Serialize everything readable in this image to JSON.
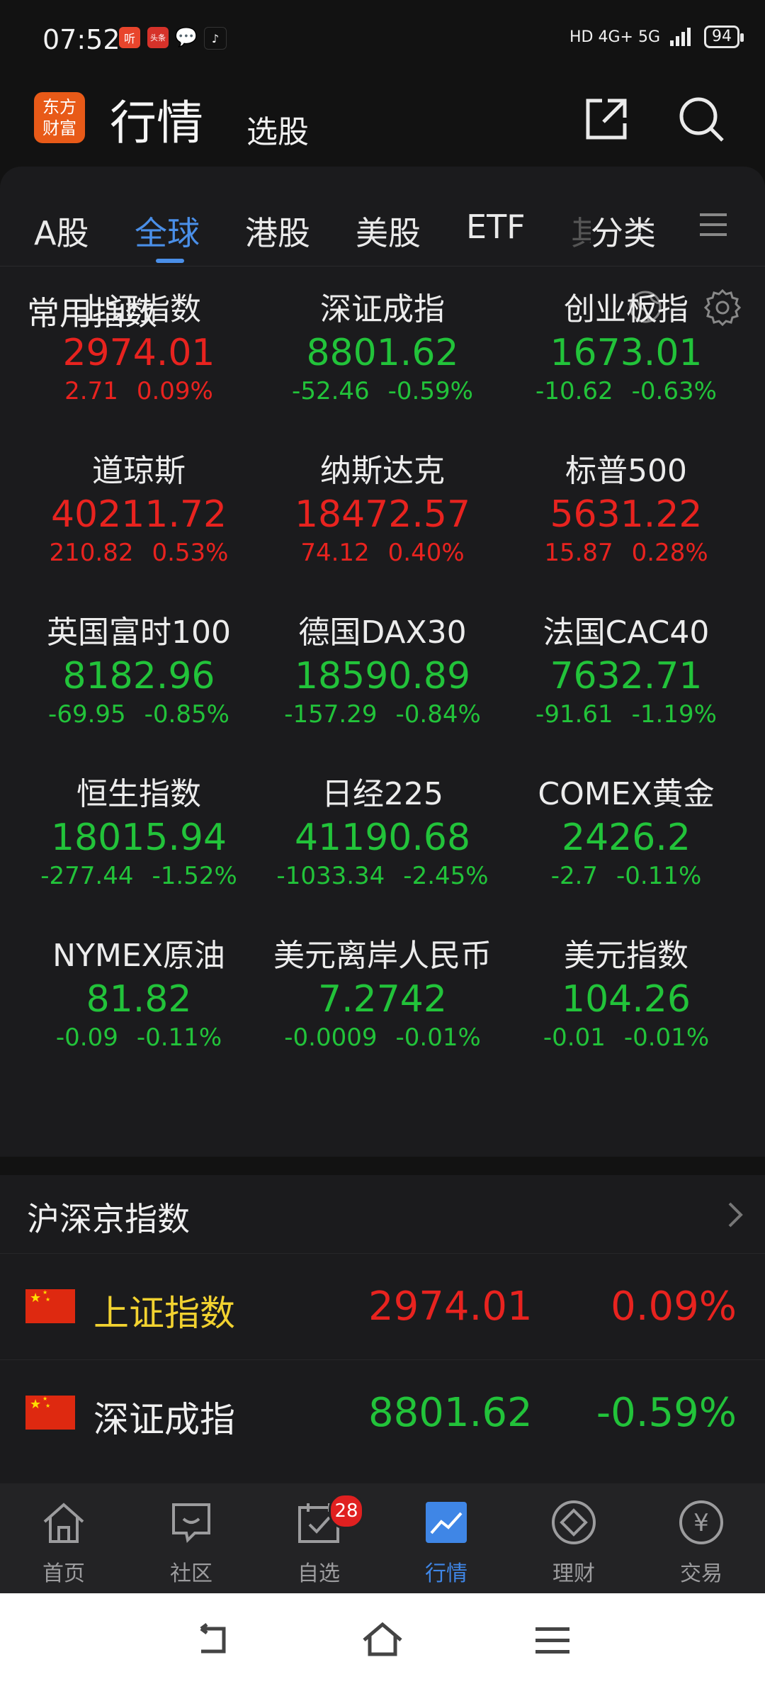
{
  "status": {
    "time": "07:52",
    "apps": [
      "听",
      "头条",
      "💬",
      "♪"
    ],
    "network": "HD 4G+ 5G",
    "battery": "94"
  },
  "header": {
    "logo_line1": "东方",
    "logo_line2": "财富",
    "title": "行情",
    "subtitle": "选股"
  },
  "tabs": [
    "A股",
    "全球",
    "港股",
    "美股",
    "ETF",
    "其",
    "分类"
  ],
  "common_indices": {
    "title": "常用指数",
    "items": [
      {
        "name": "上证指数",
        "price": "2974.01",
        "change": "2.71",
        "pct": "0.09%",
        "dir": "up"
      },
      {
        "name": "深证成指",
        "price": "8801.62",
        "change": "-52.46",
        "pct": "-0.59%",
        "dir": "down"
      },
      {
        "name": "创业板指",
        "price": "1673.01",
        "change": "-10.62",
        "pct": "-0.63%",
        "dir": "down"
      },
      {
        "name": "道琼斯",
        "price": "40211.72",
        "change": "210.82",
        "pct": "0.53%",
        "dir": "up"
      },
      {
        "name": "纳斯达克",
        "price": "18472.57",
        "change": "74.12",
        "pct": "0.40%",
        "dir": "up"
      },
      {
        "name": "标普500",
        "price": "5631.22",
        "change": "15.87",
        "pct": "0.28%",
        "dir": "up"
      },
      {
        "name": "英国富时100",
        "price": "8182.96",
        "change": "-69.95",
        "pct": "-0.85%",
        "dir": "down"
      },
      {
        "name": "德国DAX30",
        "price": "18590.89",
        "change": "-157.29",
        "pct": "-0.84%",
        "dir": "down"
      },
      {
        "name": "法国CAC40",
        "price": "7632.71",
        "change": "-91.61",
        "pct": "-1.19%",
        "dir": "down"
      },
      {
        "name": "恒生指数",
        "price": "18015.94",
        "change": "-277.44",
        "pct": "-1.52%",
        "dir": "down"
      },
      {
        "name": "日经225",
        "price": "41190.68",
        "change": "-1033.34",
        "pct": "-2.45%",
        "dir": "down"
      },
      {
        "name": "COMEX黄金",
        "price": "2426.2",
        "change": "-2.7",
        "pct": "-0.11%",
        "dir": "down"
      },
      {
        "name": "NYMEX原油",
        "price": "81.82",
        "change": "-0.09",
        "pct": "-0.11%",
        "dir": "down"
      },
      {
        "name": "美元离岸人民币",
        "price": "7.2742",
        "change": "-0.0009",
        "pct": "-0.01%",
        "dir": "down"
      },
      {
        "name": "美元指数",
        "price": "104.26",
        "change": "-0.01",
        "pct": "-0.01%",
        "dir": "down"
      }
    ]
  },
  "hsj": {
    "title": "沪深京指数",
    "rows": [
      {
        "name": "上证指数",
        "price": "2974.01",
        "pct": "0.09%",
        "dir": "up",
        "name_color": "#f2d230"
      },
      {
        "name": "深证成指",
        "price": "8801.62",
        "pct": "-0.59%",
        "dir": "down",
        "name_color": "#f0f0f0"
      }
    ]
  },
  "bottom_nav": [
    {
      "label": "首页",
      "icon": "home-icon",
      "active": false
    },
    {
      "label": "社区",
      "icon": "community-icon",
      "active": false
    },
    {
      "label": "自选",
      "icon": "watchlist-icon",
      "active": false,
      "badge": "28"
    },
    {
      "label": "行情",
      "icon": "market-icon",
      "active": true
    },
    {
      "label": "理财",
      "icon": "wealth-icon",
      "active": false
    },
    {
      "label": "交易",
      "icon": "trade-icon",
      "active": false
    }
  ],
  "colors": {
    "up": "#e8231f",
    "down": "#22c33a",
    "accent": "#4a8fe8",
    "background": "#121212"
  }
}
